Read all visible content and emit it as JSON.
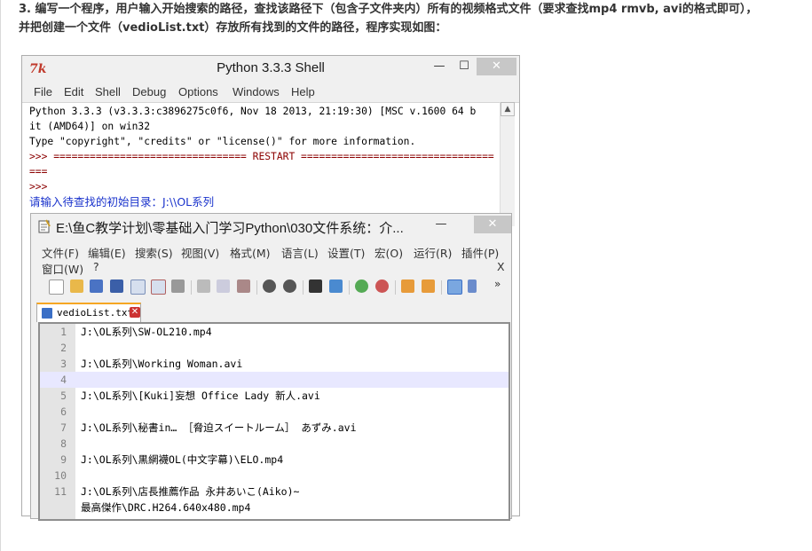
{
  "question": {
    "line1": "3. 编写一个程序，用户输入开始搜索的路径，查找该路径下（包含子文件夹内）所有的视频格式文件（要求查找mp4 rmvb, avi的格式即可），",
    "line2": "并把创建一个文件（vedioList.txt）存放所有找到的文件的路径，程序实现如图："
  },
  "shell": {
    "icon": "7k",
    "title": "Python 3.3.3 Shell",
    "min_glyph": "—",
    "max_glyph": "☐",
    "close_glyph": "✕",
    "menu": [
      "File",
      "Edit",
      "Shell",
      "Debug",
      "Options",
      "Windows",
      "Help"
    ],
    "lines": [
      "Python 3.3.3 (v3.3.3:c3896275c0f6, Nov 18 2013, 21:19:30) [MSC v.1600 64 b",
      "it (AMD64)] on win32",
      "Type \"copyright\", \"credits\" or \"license()\" for more information.",
      ">>> ================================ RESTART ================================",
      "===",
      ">>> ",
      "请输入待查找的初始目录：J:\\\\OL系列"
    ],
    "scroll_up": "▲"
  },
  "npp": {
    "title": "E:\\鱼C教学计划\\零基础入门学习Python\\030文件系统：介...",
    "min_glyph": "—",
    "close_glyph": "✕",
    "menu_row1": [
      "文件(F)",
      "编辑(E)",
      "搜索(S)",
      "视图(V)",
      "格式(M)",
      "语言(L)",
      "设置(T)",
      "宏(O)",
      "运行(R)",
      "插件(P)"
    ],
    "menu_row2": [
      "窗口(W)",
      "?"
    ],
    "menu_close": "X",
    "toolbar_more": "»",
    "tab_label": "vedioList.txt",
    "tab_close": "✕",
    "line_numbers": [
      "1",
      "2",
      "3",
      "4",
      "5",
      "6",
      "7",
      "8",
      "9",
      "10",
      "11",
      ""
    ],
    "lines": [
      "J:\\OL系列\\SW-OL210.mp4",
      "",
      "J:\\OL系列\\Working Woman.avi",
      "",
      "J:\\OL系列\\[Kuki]妄想 Office Lady 新人.avi",
      "",
      "J:\\OL系列\\秘書in… ［脅迫スイートルーム］ あずみ.avi",
      "",
      "J:\\OL系列\\黒網襪OL(中文字幕)\\ELO.mp4",
      "",
      "J:\\OL系列\\店長推薦作品 永井あいこ(Aiko)~",
      "最高傑作\\DRC.H264.640x480.mp4"
    ]
  }
}
